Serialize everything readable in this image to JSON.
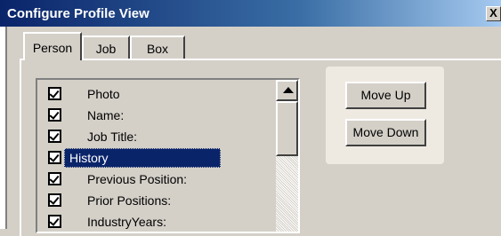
{
  "window": {
    "title": "Configure Profile View",
    "close_label": "X"
  },
  "tabs": [
    {
      "label": "Person",
      "active": true
    },
    {
      "label": "Job",
      "active": false
    },
    {
      "label": "Box",
      "active": false
    }
  ],
  "fields": [
    {
      "label": "Photo",
      "checked": true,
      "selected": false
    },
    {
      "label": "Name:",
      "checked": true,
      "selected": false
    },
    {
      "label": "Job Title:",
      "checked": true,
      "selected": false
    },
    {
      "label": "History",
      "checked": true,
      "selected": true
    },
    {
      "label": "Previous Position:",
      "checked": true,
      "selected": false
    },
    {
      "label": "Prior Positions:",
      "checked": true,
      "selected": false
    },
    {
      "label": "IndustryYears:",
      "checked": true,
      "selected": false
    }
  ],
  "buttons": {
    "move_up": "Move Up",
    "move_down": "Move Down"
  },
  "colors": {
    "title_start": "#0a246a",
    "title_end": "#a6caf0",
    "selection": "#0a246a",
    "face": "#d4d0c8"
  }
}
